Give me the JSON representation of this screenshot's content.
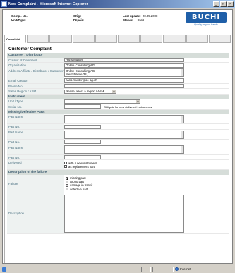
{
  "window": {
    "title": "New Complaint - Microsoft Internet Explorer"
  },
  "header": {
    "row1": {
      "label": "Compl. No.:",
      "value": "",
      "label2": "Orig.:",
      "value2": "",
      "label3": "Last update:",
      "value3": "20.05.2008"
    },
    "row2": {
      "label": "Unit/Type:",
      "value": "",
      "label2": "Repair:",
      "value2": "",
      "label3": "Status:",
      "value3": "Draft"
    },
    "logo_text": "BÜCHI",
    "logo_tagline": "Quality in your hands"
  },
  "tabs": [
    "Complaint",
    "",
    "",
    "",
    "",
    "",
    "",
    "",
    "",
    ""
  ],
  "form": {
    "title": "Customer Complaint",
    "sections": {
      "customer": "Customer / Distributor",
      "instrument": "Instrument",
      "parts": "Missing/Defective Parts",
      "failure": "Description of the failure"
    },
    "fields": {
      "creator": {
        "label": "Creator of Complaint",
        "value": "Hans Muster"
      },
      "organization": {
        "label": "Organization",
        "value": "Online Consulting AG"
      },
      "address": {
        "label": "Address Affiliate / Distributor / Customer",
        "line1": "Online Consulting AG,",
        "line2": "Weststrasse 38,"
      },
      "email": {
        "label": "Email Creator",
        "value": "hans.muster@oc-ag.ch"
      },
      "phone": {
        "label": "Phone No.",
        "value": ""
      },
      "region": {
        "label": "Sales Region / ASM",
        "value": "please select a region / ASM"
      },
      "unit_type": {
        "label": "Unit / Type",
        "value": ""
      },
      "serial": {
        "label": "Serial No.",
        "value": "",
        "note": "Obligate for new delivered instruments"
      },
      "part_name_label": "Part Name",
      "part_no_label": "Part No.",
      "delivered": {
        "label": "Delivered",
        "opt1": "with a new instrument",
        "opt2": "as replacement part"
      },
      "failure": {
        "label": "Failure",
        "options": [
          "missing part",
          "wrong part",
          "damage in transit",
          "defective part"
        ]
      },
      "description": {
        "label": "Description",
        "value": ""
      }
    }
  },
  "status": {
    "left": "",
    "zone": "Internet"
  }
}
